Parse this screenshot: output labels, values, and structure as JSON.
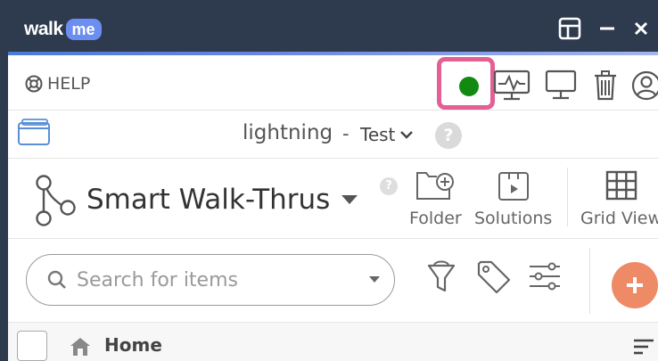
{
  "titlebar": {
    "logo_part1": "walk",
    "logo_part2": "me"
  },
  "toolbar": {
    "help_label": "HELP",
    "status_color": "#128a12",
    "highlight_color": "#e35f95"
  },
  "environment": {
    "name": "lightning",
    "separator": "-",
    "selected": "Test",
    "help_symbol": "?"
  },
  "section": {
    "title": "Smart Walk-Thrus",
    "help_symbol": "?",
    "actions": [
      {
        "label": "Folder",
        "icon": "folder-plus-icon"
      },
      {
        "label": "Solutions",
        "icon": "solutions-icon"
      },
      {
        "label": "Grid View",
        "icon": "grid-icon"
      }
    ]
  },
  "search": {
    "placeholder": "Search for items"
  },
  "list": {
    "home_label": "Home"
  },
  "colors": {
    "titlebar_bg": "#2e3a4d",
    "add_button": "#ee8a66"
  }
}
